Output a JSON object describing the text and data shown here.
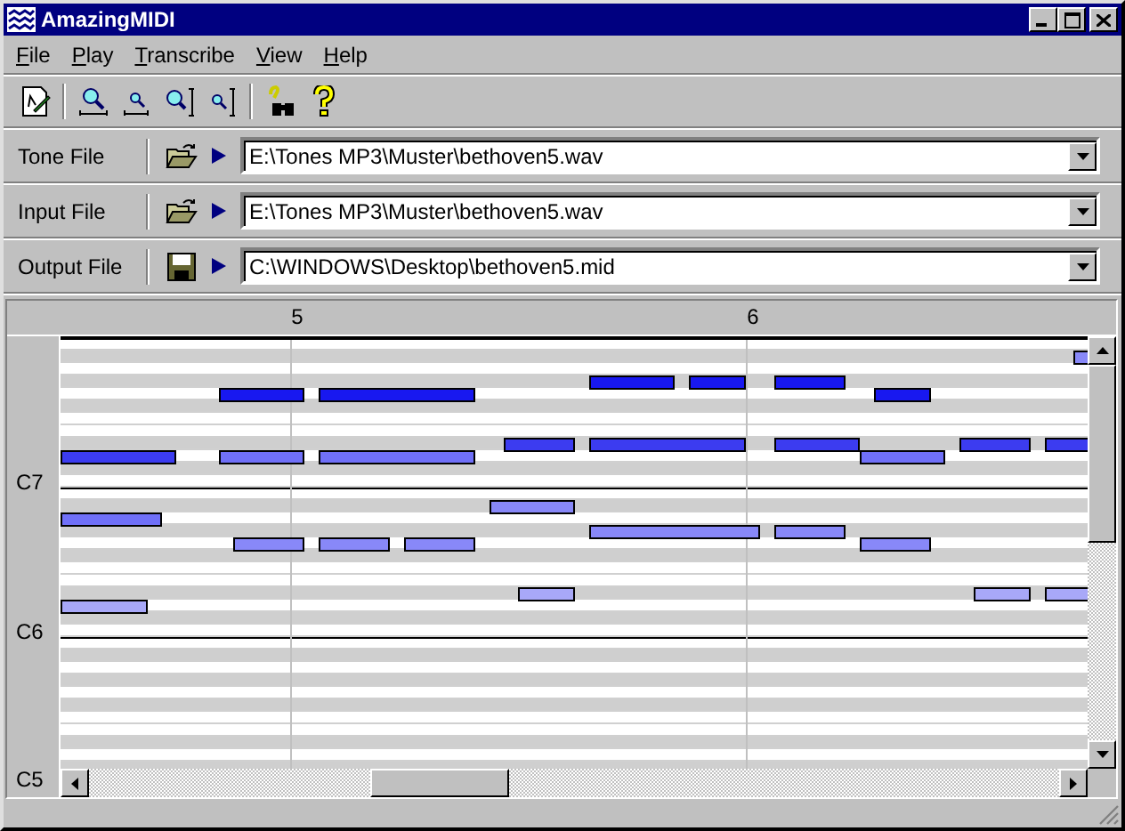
{
  "window": {
    "title": "AmazingMIDI"
  },
  "menu": [
    "File",
    "Play",
    "Transcribe",
    "View",
    "Help"
  ],
  "files": [
    {
      "label": "Tone File",
      "kind": "open",
      "path": "E:\\Tones MP3\\Muster\\bethoven5.wav"
    },
    {
      "label": "Input File",
      "kind": "open",
      "path": "E:\\Tones MP3\\Muster\\bethoven5.wav"
    },
    {
      "label": "Output File",
      "kind": "save",
      "path": "C:\\WINDOWS\\Desktop\\bethoven5.mid"
    }
  ],
  "ruler": [
    "5",
    "6"
  ],
  "keys": [
    "C7",
    "C6",
    "C5"
  ]
}
